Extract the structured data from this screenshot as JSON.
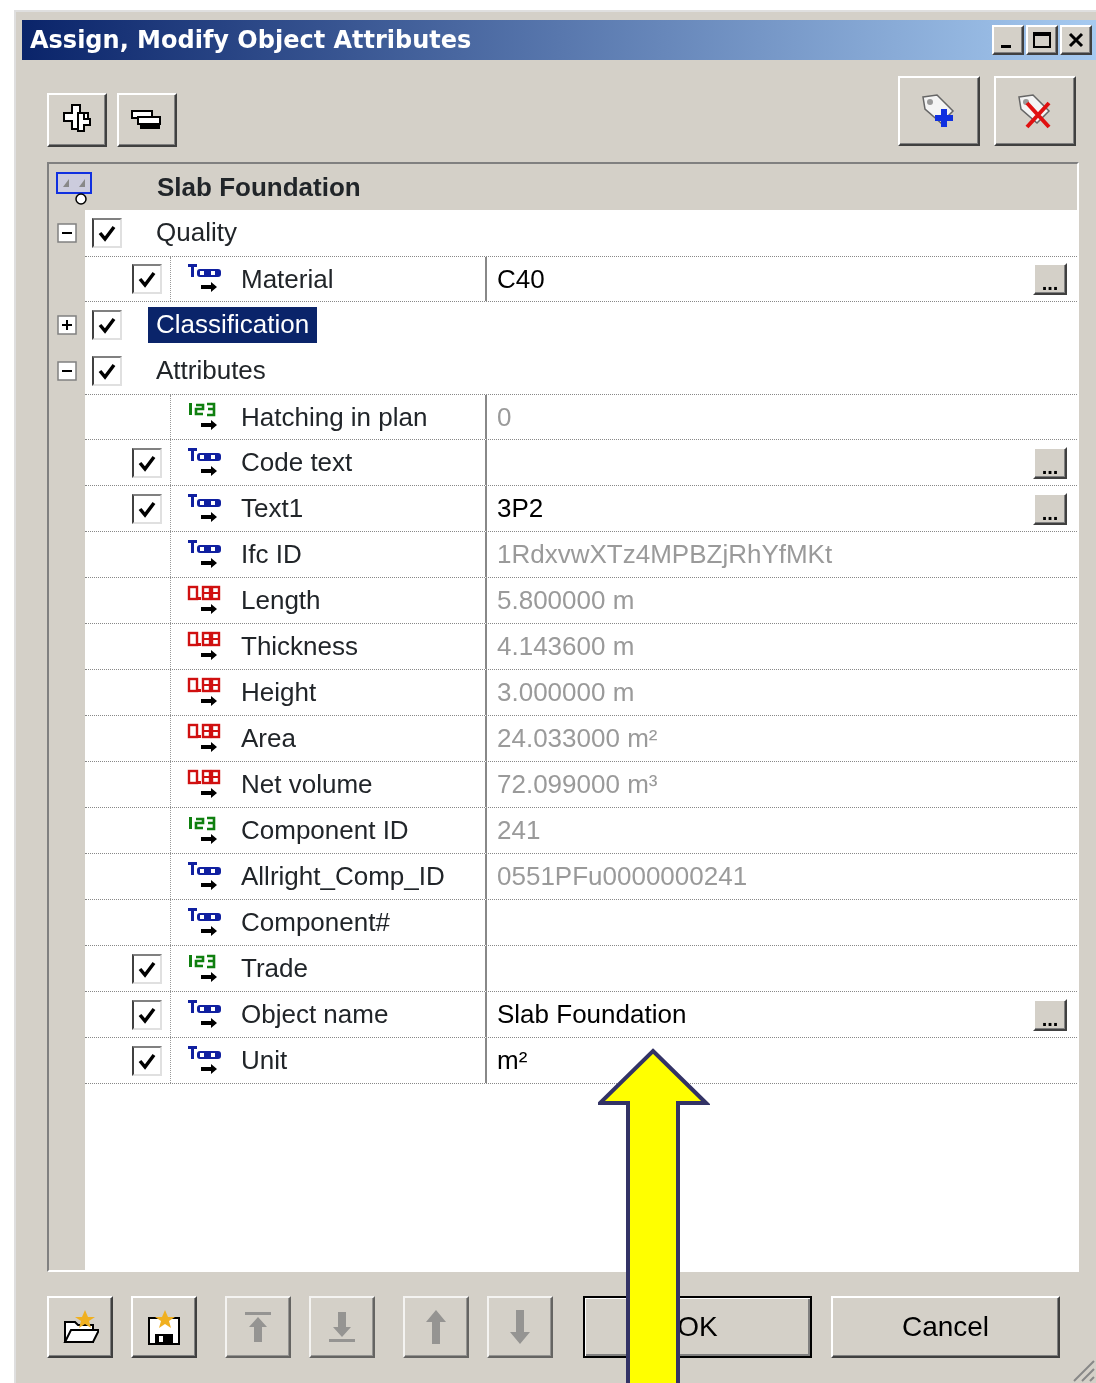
{
  "window": {
    "title": "Assign, Modify Object Attributes"
  },
  "header": {
    "object": "Slab Foundation"
  },
  "groups": [
    {
      "label": "Quality",
      "expanded": true,
      "checked": true,
      "selected": false,
      "children": [
        {
          "label": "Material",
          "kind": "text",
          "checked": true,
          "value": "C40",
          "disabled": false,
          "browse": "..."
        }
      ]
    },
    {
      "label": "Classification",
      "expanded": false,
      "checked": true,
      "selected": true
    },
    {
      "label": "Attributes",
      "expanded": true,
      "checked": true,
      "selected": false,
      "children": [
        {
          "label": "Hatching in plan",
          "kind": "integer",
          "value": "0",
          "disabled": true
        },
        {
          "label": "Code text",
          "kind": "text",
          "checked": true,
          "browse": "..."
        },
        {
          "label": "Text1",
          "kind": "text",
          "checked": true,
          "value": "3P2",
          "disabled": false,
          "browse": "..."
        },
        {
          "label": "Ifc ID",
          "kind": "text",
          "value": "1RdxvwXTz4MPBZjRhYfMKt",
          "disabled": true
        },
        {
          "label": "Length",
          "kind": "decimal",
          "value": "5.800000 m",
          "disabled": true
        },
        {
          "label": "Thickness",
          "kind": "decimal",
          "value": "4.143600 m",
          "disabled": true
        },
        {
          "label": "Height",
          "kind": "decimal",
          "value": "3.000000 m",
          "disabled": true
        },
        {
          "label": "Area",
          "kind": "decimal",
          "value": "24.033000 m²",
          "disabled": true
        },
        {
          "label": "Net volume",
          "kind": "decimal",
          "value": "72.099000 m³",
          "disabled": true
        },
        {
          "label": "Component ID",
          "kind": "integer",
          "value": "241",
          "disabled": true
        },
        {
          "label": "Allright_Comp_ID",
          "kind": "text",
          "value": "0551PFu0000000241",
          "disabled": true
        },
        {
          "label": "Component#",
          "kind": "text"
        },
        {
          "label": "Trade",
          "kind": "integer",
          "checked": true
        },
        {
          "label": "Object name",
          "kind": "text",
          "checked": true,
          "value": "Slab Foundation",
          "disabled": false,
          "browse": "..."
        },
        {
          "label": "Unit",
          "kind": "text",
          "checked": true,
          "value": "m²",
          "disabled": false
        }
      ]
    }
  ],
  "bottom_buttons": [
    {
      "kind": "open",
      "disabled": false
    },
    {
      "kind": "save",
      "disabled": false
    },
    {
      "kind": "top",
      "disabled": true
    },
    {
      "kind": "bottom",
      "disabled": true
    },
    {
      "kind": "up",
      "disabled": true
    },
    {
      "kind": "down",
      "disabled": true
    }
  ],
  "dialog_buttons": [
    {
      "label": "OK",
      "default": true
    },
    {
      "label": "Cancel",
      "default": false
    }
  ]
}
